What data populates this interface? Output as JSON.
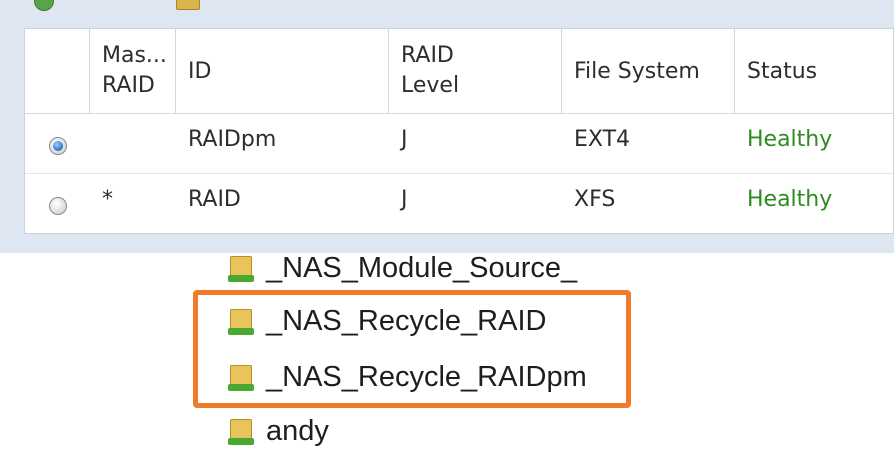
{
  "raid_table": {
    "columns": [
      {
        "label": "",
        "two_line": false
      },
      {
        "label": "Mas...\nRAID",
        "two_line": true
      },
      {
        "label": "ID",
        "two_line": false
      },
      {
        "label": "RAID\nLevel",
        "two_line": true
      },
      {
        "label": "File System",
        "two_line": false
      },
      {
        "label": "Status",
        "two_line": false
      }
    ],
    "rows": [
      {
        "selected": true,
        "master": "",
        "id": "RAIDpm",
        "level": "J",
        "fs": "EXT4",
        "status": "Healthy"
      },
      {
        "selected": false,
        "master": "*",
        "id": "RAID",
        "level": "J",
        "fs": "XFS",
        "status": "Healthy"
      }
    ],
    "status_color": "#2e8b22"
  },
  "folders": [
    {
      "name": "_NAS_Module_Source_"
    },
    {
      "name": "_NAS_Recycle_RAID"
    },
    {
      "name": "_NAS_Recycle_RAIDpm"
    },
    {
      "name": "andy"
    }
  ],
  "highlight_color": "#f07b2a"
}
